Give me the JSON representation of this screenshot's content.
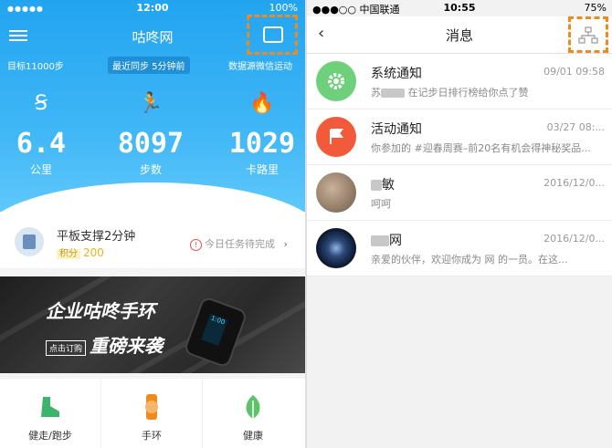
{
  "left": {
    "status_bar": {
      "time": "12:00",
      "battery": "100%"
    },
    "header": {
      "title": "咕咚网",
      "goal": "目标11000步",
      "sync": "最近同步 5分钟前",
      "source": "数据源微信运动"
    },
    "stats": [
      {
        "icon": "distance-icon",
        "value": "6.4",
        "label": "公里"
      },
      {
        "icon": "runner-icon",
        "value": "8097",
        "label": "步数"
      },
      {
        "icon": "flame-icon",
        "value": "1029",
        "label": "卡路里"
      }
    ],
    "task": {
      "title": "平板支撑2分钟",
      "points_tag": "积分",
      "points": "200",
      "status": "今日任务待完成"
    },
    "banner": {
      "headline1": "企业咕咚手环",
      "headline2": "重磅来袭",
      "button": "点击订购",
      "band_screen": "1:00"
    },
    "tabs": [
      {
        "label": "健走/跑步",
        "icon": "shoe-icon",
        "color": "#3bb56b"
      },
      {
        "label": "手环",
        "icon": "band-icon",
        "color": "#f08a1c"
      },
      {
        "label": "健康",
        "icon": "leaf-icon",
        "color": "#5cc36a"
      }
    ],
    "colors": {
      "primary": "#22a4f0",
      "highlight": "#f08a1c"
    }
  },
  "right": {
    "status_bar": {
      "carrier": "●●●○○ 中国联通",
      "time": "10:55",
      "battery": "75%"
    },
    "nav": {
      "back": "‹",
      "title": "消息"
    },
    "messages": [
      {
        "title": "系统通知",
        "date": "09/01 09:58",
        "pre": "苏",
        "post": " 在记步日排行榜给你点了赞",
        "avatar_color": "#6fd07c",
        "avatar_icon": "gear-icon"
      },
      {
        "title": "活动通知",
        "date": "03/27 08:...",
        "pre": "",
        "post": "你参加的 #迎春周赛–前20名有机会得神秘奖品...",
        "avatar_color": "#f25a3a",
        "avatar_icon": "flag-icon"
      },
      {
        "title": "敏",
        "date": "2016/12/0...",
        "pre": "",
        "post": "呵呵",
        "avatar_color": "#8a7060",
        "avatar_icon": "photo-avatar"
      },
      {
        "title": "网",
        "date": "2016/12/0...",
        "pre": "",
        "post": "亲爱的伙伴，欢迎你成为 网 的一员。在这...",
        "avatar_color": "#1c2a4a",
        "avatar_icon": "galaxy-avatar"
      }
    ]
  }
}
